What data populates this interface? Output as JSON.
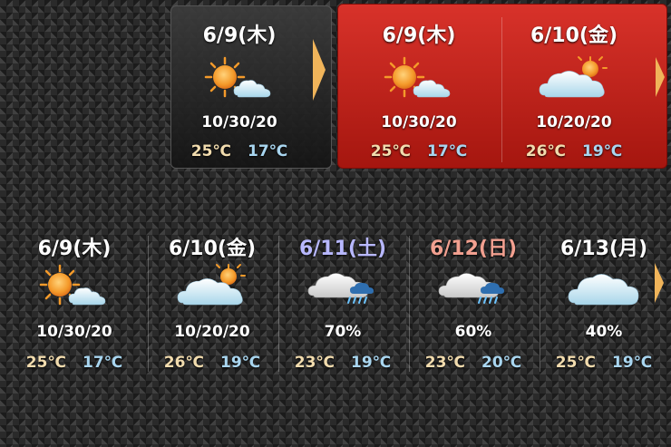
{
  "colors": {
    "high_temp": "#f2dcae",
    "low_temp": "#a9d6f0",
    "saturday": "#b8b8ff",
    "sunday": "#f2a090",
    "arrow": "#f0b45a"
  },
  "top_dark": {
    "date": "6/9(木)",
    "icon": "sun-cloud-icon",
    "info": "10/30/20",
    "high": "25℃",
    "low": "17℃"
  },
  "top_red": [
    {
      "date": "6/9(木)",
      "icon": "sun-cloud-icon",
      "info": "10/30/20",
      "high": "25℃",
      "low": "17℃"
    },
    {
      "date": "6/10(金)",
      "icon": "cloud-sun-icon",
      "info": "10/20/20",
      "high": "26℃",
      "low": "19℃"
    }
  ],
  "bottom_row": [
    {
      "date": "6/9(木)",
      "icon": "sun-cloud-icon",
      "info": "10/30/20",
      "high": "25℃",
      "low": "17℃"
    },
    {
      "date": "6/10(金)",
      "icon": "cloud-sun-icon",
      "info": "10/20/20",
      "high": "26℃",
      "low": "19℃"
    },
    {
      "date": "6/11(土)",
      "icon": "cloud-rain-icon",
      "info": "70%",
      "high": "23℃",
      "low": "19℃"
    },
    {
      "date": "6/12(日)",
      "icon": "cloud-rain-icon",
      "info": "60%",
      "high": "23℃",
      "low": "20℃"
    },
    {
      "date": "6/13(月)",
      "icon": "cloud-icon",
      "info": "40%",
      "high": "25℃",
      "low": "19℃"
    }
  ]
}
